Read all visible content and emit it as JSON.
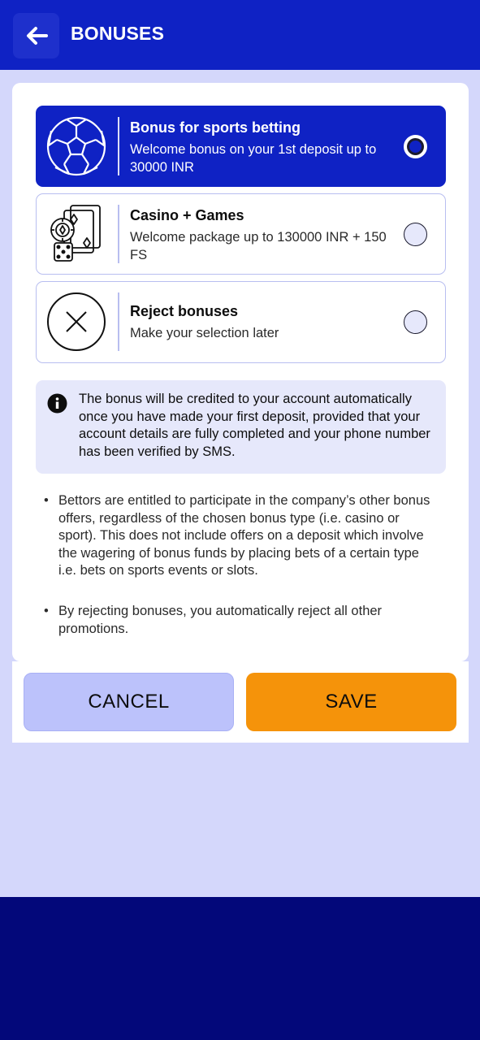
{
  "header": {
    "title": "BONUSES",
    "back_icon": "arrow-left-icon"
  },
  "options": [
    {
      "title": "Bonus for sports betting",
      "desc": "Welcome bonus on your 1st deposit up to 30000 INR",
      "icon": "soccer-ball-icon",
      "selected": true
    },
    {
      "title": "Casino + Games",
      "desc": "Welcome package up to 130000 INR + 150 FS",
      "icon": "casino-cards-dice-icon",
      "selected": false
    },
    {
      "title": "Reject bonuses",
      "desc": "Make your selection later",
      "icon": "reject-x-icon",
      "selected": false
    }
  ],
  "info": {
    "text": "The bonus will be credited to your account automatically once you have made your first deposit, provided that your account details are fully completed and your phone number has been verified by SMS.",
    "icon": "info-icon"
  },
  "bullets": [
    "Bettors are entitled to participate in the company’s other bonus offers, regardless of the chosen bonus type (i.e. casino or sport). This does not include offers on a deposit which involve the wagering of bonus funds by placing bets of a certain type i.e. bets on sports events or slots.",
    "By rejecting bonuses, you automatically reject all other promotions."
  ],
  "buttons": {
    "cancel": "CANCEL",
    "save": "SAVE"
  },
  "colors": {
    "primary": "#0f22c4",
    "save": "#f5930a",
    "cancel": "#bcc2fb",
    "background": "#d4d7fb",
    "bottom_band": "#03087a"
  }
}
